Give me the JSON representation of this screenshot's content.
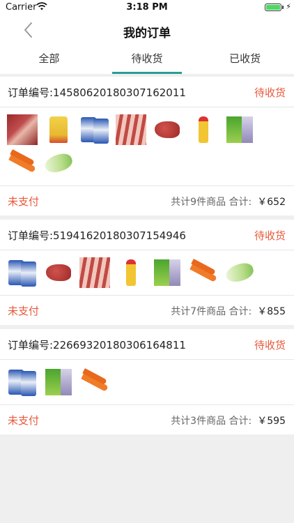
{
  "status_bar": {
    "carrier": "Carrier",
    "time": "3:18 PM"
  },
  "nav": {
    "title": "我的订单"
  },
  "tabs": [
    {
      "label": "全部"
    },
    {
      "label": "待收货",
      "active": true
    },
    {
      "label": "已收货"
    }
  ],
  "orders": [
    {
      "number": "订单编号:14580620180307162011",
      "state": "待收货",
      "payment": "未支付",
      "summary": "共计9件商品 合计:",
      "amount": "￥652",
      "items": [
        "meat-icon",
        "yellow-bag-icon",
        "blue-bag-icon",
        "ribs-icon",
        "beef-icon",
        "oil-bottle-icon",
        "vegetable-pack-icon",
        "carrot-icon",
        "cabbage-icon"
      ]
    },
    {
      "number": "订单编号:51941620180307154946",
      "state": "待收货",
      "payment": "未支付",
      "summary": "共计7件商品 合计:",
      "amount": "￥855",
      "items": [
        "blue-bag-icon",
        "beef-icon",
        "ribs-icon",
        "oil-bottle-icon",
        "vegetable-pack-icon",
        "carrot-icon",
        "cabbage-icon"
      ]
    },
    {
      "number": "订单编号:22669320180306164811",
      "state": "待收货",
      "payment": "未支付",
      "summary": "共计3件商品 合计:",
      "amount": "￥595",
      "items": [
        "blue-bag-icon",
        "vegetable-pack-icon",
        "carrot-icon"
      ]
    }
  ],
  "colors": {
    "accent": "#2a9d93",
    "alert": "#e9583a",
    "background": "#efefef"
  }
}
